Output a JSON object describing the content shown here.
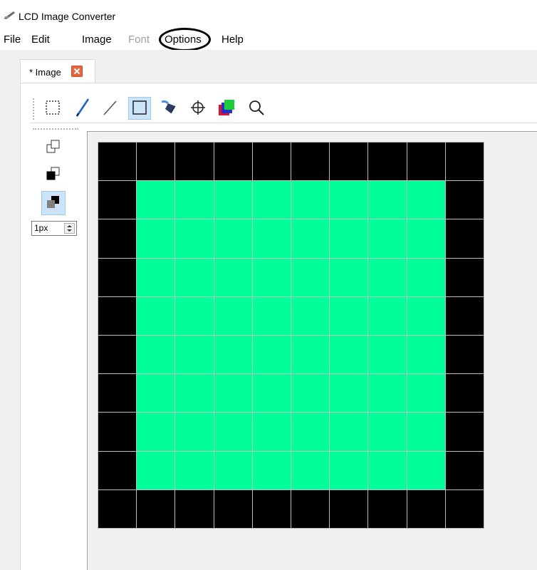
{
  "window": {
    "title": "LCD Image Converter"
  },
  "menubar": {
    "items": [
      {
        "label": "File",
        "enabled": true
      },
      {
        "label": "Edit",
        "enabled": true
      },
      {
        "label": "Image",
        "enabled": true
      },
      {
        "label": "Font",
        "enabled": false
      },
      {
        "label": "Options",
        "enabled": true,
        "highlighted": true
      },
      {
        "label": "Help",
        "enabled": true
      }
    ]
  },
  "tabs": [
    {
      "label": "* Image",
      "close_icon": "close-icon",
      "active": true
    }
  ],
  "toolbar": {
    "tools": [
      {
        "name": "select-rect-icon"
      },
      {
        "name": "pen-icon"
      },
      {
        "name": "line-icon"
      },
      {
        "name": "rectangle-icon",
        "active": true
      },
      {
        "name": "fill-icon"
      },
      {
        "name": "move-icon"
      },
      {
        "name": "color-swap-icon"
      },
      {
        "name": "zoom-icon"
      }
    ]
  },
  "side_toolbar": {
    "modes": [
      {
        "name": "outline-mode-icon"
      },
      {
        "name": "filled-mode-icon"
      },
      {
        "name": "filled-outline-mode-icon",
        "active": true
      }
    ],
    "line_width": {
      "value": "1px"
    }
  },
  "canvas": {
    "columns": 10,
    "rows": 10,
    "fill_color": "#00ff99",
    "border_color": "#000000",
    "grid_color": "#bdbdbd",
    "pixels": [
      "BBBBBBBBBB",
      "BGGGGGGGGB",
      "BGGGGGGGGB",
      "BGGGGGGGGB",
      "BGGGGGGGGB",
      "BGGGGGGGGB",
      "BGGGGGGGGB",
      "BGGGGGGGGB",
      "BGGGGGGGGB",
      "BBBBBBBBBB"
    ]
  },
  "colors": {
    "accent": "#cce4f7",
    "close_button": "#e8663f",
    "disabled_text": "#a0a0a0"
  }
}
